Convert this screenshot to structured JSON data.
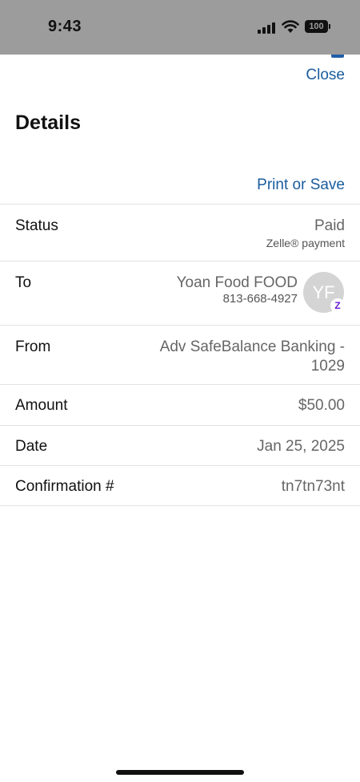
{
  "status_bar": {
    "time": "9:43",
    "battery": "100"
  },
  "header": {
    "close_label": "Close",
    "title": "Details",
    "print_label": "Print or Save"
  },
  "rows": {
    "status": {
      "label": "Status",
      "value": "Paid",
      "sub": "Zelle® payment"
    },
    "to": {
      "label": "To",
      "name": "Yoan Food FOOD",
      "phone": "813-668-4927",
      "avatar_initials": "YF",
      "badge": "Z"
    },
    "from": {
      "label": "From",
      "line1": "Adv SafeBalance Banking -",
      "line2": "1029"
    },
    "amount": {
      "label": "Amount",
      "value": "$50.00"
    },
    "date": {
      "label": "Date",
      "value": "Jan 25, 2025"
    },
    "confirmation": {
      "label": "Confirmation #",
      "value": "tn7tn73nt"
    }
  },
  "colors": {
    "link": "#1a5c9e",
    "status_bar_bg": "#9c9c9c",
    "zelle_purple": "#6d1ed4"
  }
}
